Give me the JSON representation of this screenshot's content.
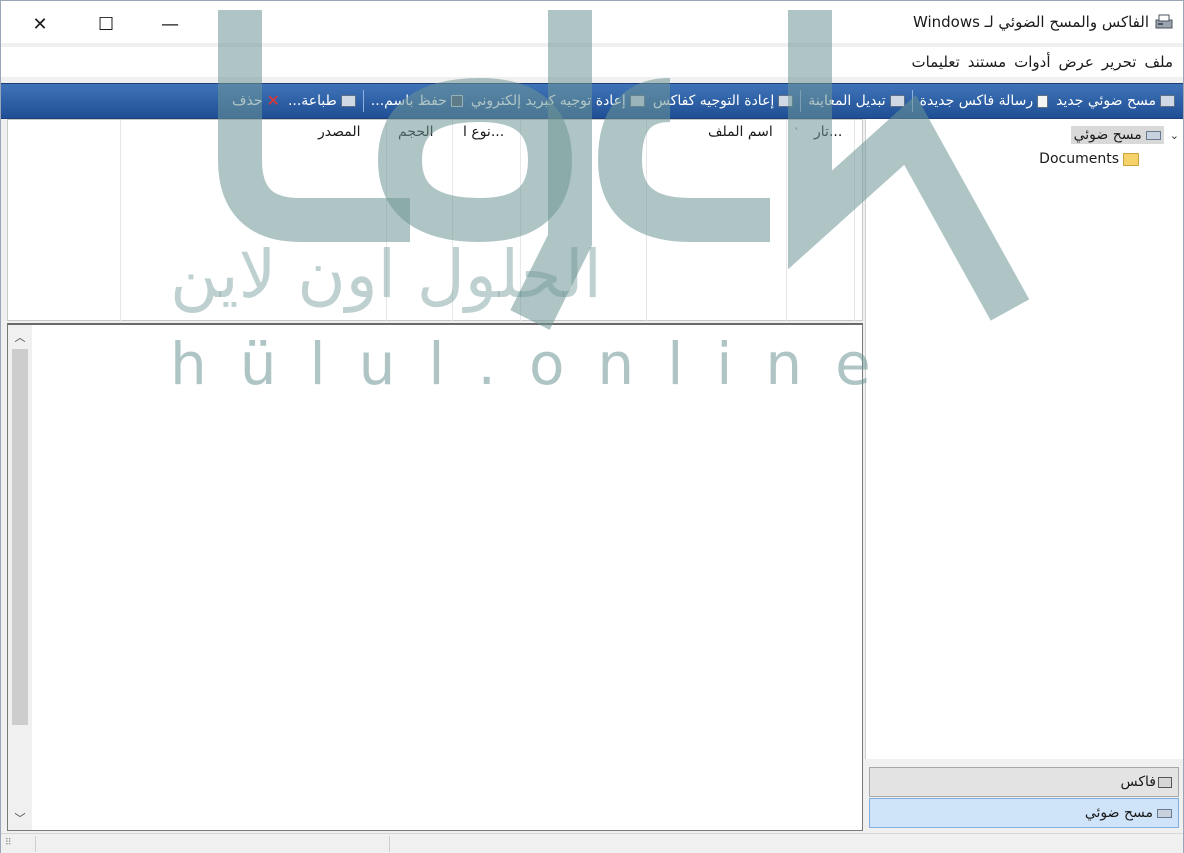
{
  "window": {
    "title": "الفاكس والمسح الضوئي لـ Windows"
  },
  "menu": [
    "ملف",
    "تحرير",
    "عرض",
    "أدوات",
    "مستند",
    "تعليمات"
  ],
  "toolbar": {
    "new_scan": "مسح ضوئي جديد",
    "new_fax": "رسالة فاكس جديدة",
    "toggle_preview": "تبديل المعاينة",
    "forward_fax": "إعادة التوجيه كفاكس",
    "forward_email": "إعادة توجيه كبريد إلكتروني",
    "save_as": "حفظ باسم...",
    "print": "طباعة...",
    "delete": "حذف"
  },
  "tree": {
    "root": "مسح ضوئي",
    "folder": "Documents"
  },
  "nav": {
    "fax": "فاكس",
    "scan": "مسح ضوئي"
  },
  "list": {
    "columns": [
      "تار...",
      "اسم الملف",
      "نوع ا...",
      "الحجم",
      "المصدر"
    ]
  },
  "watermark": {
    "arabic": "الحلول اون لاين",
    "latin": "hülul.online"
  }
}
